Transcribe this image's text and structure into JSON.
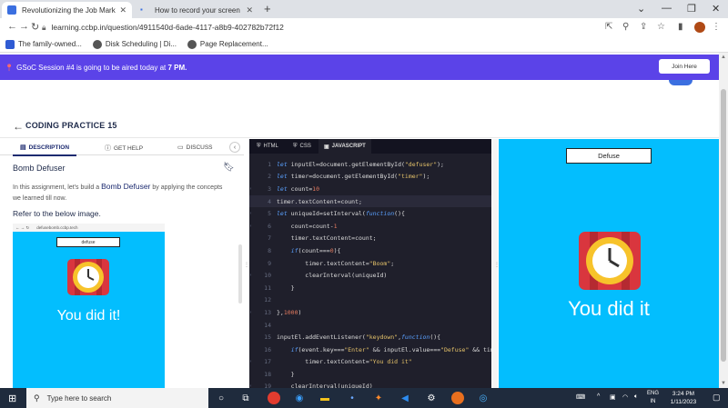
{
  "browser": {
    "tabs": [
      {
        "title": "Revolutionizing the Job Market |",
        "favicon_color": "#3b6fe0"
      },
      {
        "title": "How to record your screen in Wi",
        "favicon_color": "#3b6fe0"
      }
    ],
    "url": "learning.ccbp.in/question/4911540d-6ade-4117-a8b9-402782b72f12",
    "bookmarks": [
      {
        "label": "The family-owned...",
        "icon_color": "#2f5bd3"
      },
      {
        "label": "Disk Scheduling | Di...",
        "icon_color": "#555555"
      },
      {
        "label": "Page Replacement...",
        "icon_color": "#555555"
      }
    ]
  },
  "banner": {
    "text": "GSoC Session #4 is going to be aired today at",
    "time": "7 PM.",
    "join_label": "Join Here"
  },
  "header": {
    "title": "CODING PRACTICE 15"
  },
  "left_panel": {
    "tabs": [
      {
        "label": "DESCRIPTION",
        "icon": "book-icon"
      },
      {
        "label": "GET HELP",
        "icon": "help-icon"
      },
      {
        "label": "DISCUSS",
        "icon": "chat-icon"
      }
    ],
    "problem_title": "Bomb Defuser",
    "description_pre": "In this assignment, let's build a",
    "description_bold": "Bomb Defuser",
    "description_post": "by applying the concepts we learned till now.",
    "refer_text": "Refer to the below image.",
    "preview": {
      "url": "defusebomb.ccbp.tech",
      "input_value": "defuse",
      "message": "You did it!"
    }
  },
  "editor": {
    "tabs": [
      {
        "label": "HTML",
        "icon": "html-icon"
      },
      {
        "label": "CSS",
        "icon": "css-icon"
      },
      {
        "label": "JAVASCRIPT",
        "icon": "js-icon"
      }
    ],
    "active_tab": "JAVASCRIPT",
    "line_numbers": [
      "1",
      "2",
      "3",
      "4",
      "5",
      "6",
      "7",
      "8",
      "9",
      "10",
      "11",
      "12",
      "13",
      "14",
      "15",
      "16",
      "17",
      "18",
      "19"
    ]
  },
  "output": {
    "input_value": "Defuse",
    "message": "You did it"
  },
  "taskbar": {
    "search_placeholder": "Type here to search",
    "lang_line1": "ENG",
    "lang_line2": "IN",
    "time": "3:24 PM",
    "date": "1/11/2023"
  }
}
